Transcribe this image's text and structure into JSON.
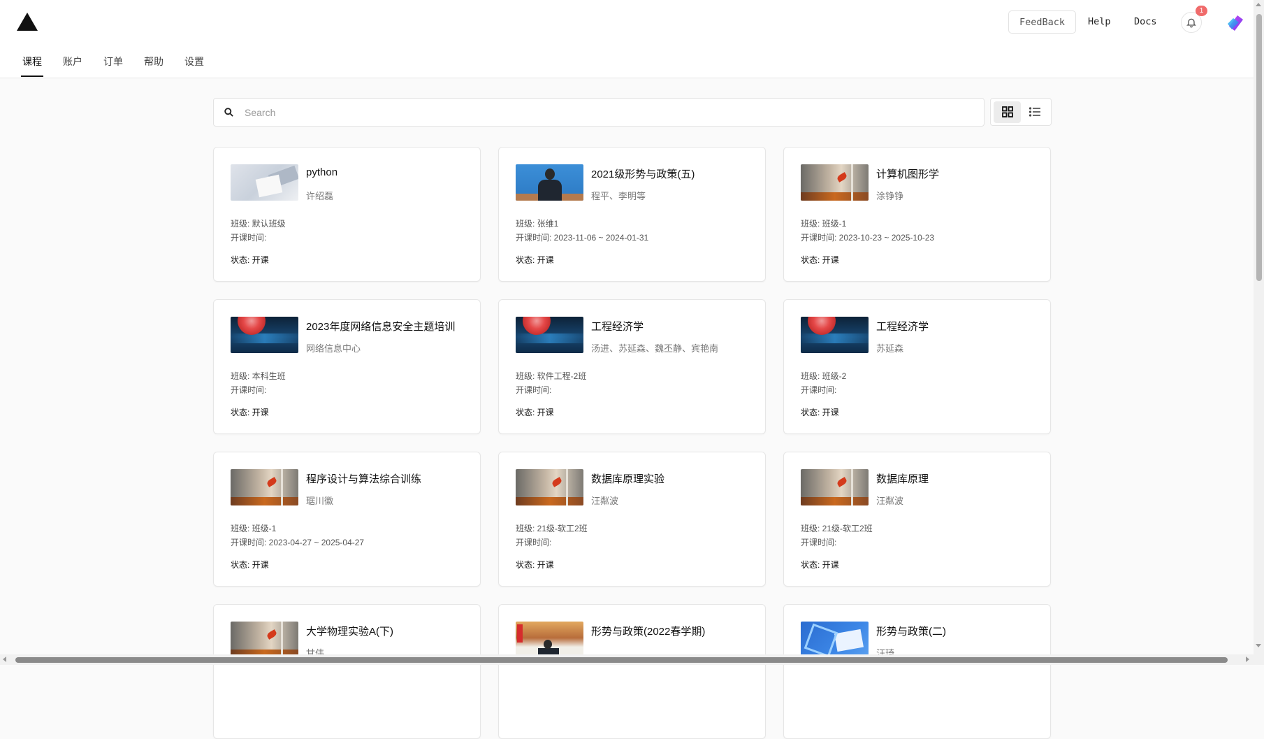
{
  "header": {
    "feedback_label": "FeedBack",
    "help_label": "Help",
    "docs_label": "Docs",
    "notification_count": "1",
    "logo_icon": "triangle-logo-icon",
    "bell_icon": "bell-icon"
  },
  "nav": {
    "tabs": [
      {
        "label": "课程",
        "active": true
      },
      {
        "label": "账户"
      },
      {
        "label": "订单"
      },
      {
        "label": "帮助"
      },
      {
        "label": "设置"
      }
    ]
  },
  "search": {
    "placeholder": "Search"
  },
  "view_toggle": {
    "active": "grid"
  },
  "colors": {
    "badge": "#f06b6b",
    "accent": "#111111"
  },
  "courses": [
    {
      "title": "python",
      "teacher": "许绍磊",
      "class": "班级: 默认班级",
      "time": "开课时间:",
      "status": "状态: 开课",
      "thumb": "desk"
    },
    {
      "title": "2021级形势与政策(五)",
      "teacher": "程平、李明等",
      "class": "班级: 张维1",
      "time": "开课时间: 2023-11-06 ~ 2024-01-31",
      "status": "状态: 开课",
      "thumb": "person"
    },
    {
      "title": "计算机图形学",
      "teacher": "涂铮铮",
      "class": "班级: 班级-1",
      "time": "开课时间: 2023-10-23 ~ 2025-10-23",
      "status": "状态: 开课",
      "thumb": "autumn"
    },
    {
      "title": "2023年度网络信息安全主题培训",
      "teacher": "网络信息中心",
      "class": "班级: 本科生班",
      "time": "开课时间:",
      "status": "状态: 开课",
      "thumb": "blue"
    },
    {
      "title": "工程经济学",
      "teacher": "汤进、苏延森、魏丕静、宾艳南",
      "class": "班级: 软件工程-2班",
      "time": "开课时间:",
      "status": "状态: 开课",
      "thumb": "blue"
    },
    {
      "title": "工程经济学",
      "teacher": "苏延森",
      "class": "班级: 班级-2",
      "time": "开课时间:",
      "status": "状态: 开课",
      "thumb": "blue"
    },
    {
      "title": "程序设计与算法综合训练",
      "teacher": "琚川徽",
      "class": "班级: 班级-1",
      "time": "开课时间: 2023-04-27 ~ 2025-04-27",
      "status": "状态: 开课",
      "thumb": "autumn"
    },
    {
      "title": "数据库原理实验",
      "teacher": "汪粼波",
      "class": "班级: 21级-软工2班",
      "time": "开课时间:",
      "status": "状态: 开课",
      "thumb": "autumn"
    },
    {
      "title": "数据库原理",
      "teacher": "汪粼波",
      "class": "班级: 21级-软工2班",
      "time": "开课时间:",
      "status": "状态: 开课",
      "thumb": "autumn"
    },
    {
      "title": "大学物理实验A(下)",
      "teacher": "甘伟",
      "class": "",
      "time": "",
      "status": "",
      "thumb": "autumn"
    },
    {
      "title": "形势与政策(2022春学期)",
      "teacher": "",
      "class": "",
      "time": "",
      "status": "",
      "thumb": "stage"
    },
    {
      "title": "形势与政策(二)",
      "teacher": "汪琦",
      "class": "",
      "time": "",
      "status": "",
      "thumb": "math"
    }
  ]
}
